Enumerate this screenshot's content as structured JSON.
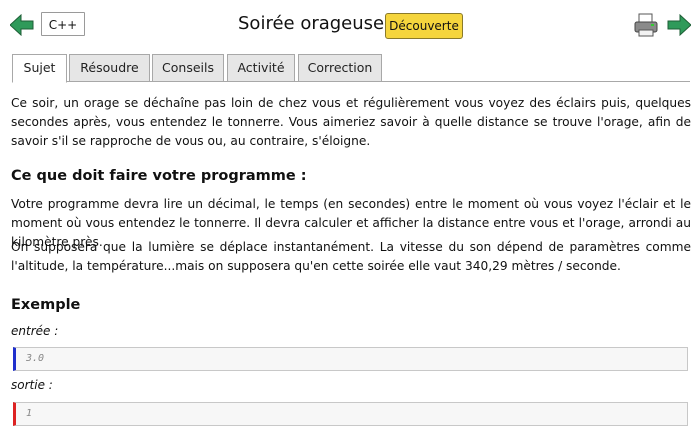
{
  "header": {
    "language_label": "C++",
    "title": "Soirée orageuse",
    "badge": "Découverte"
  },
  "tabs": [
    "Sujet",
    "Résoudre",
    "Conseils",
    "Activité",
    "Correction"
  ],
  "content": {
    "intro": "Ce soir, un orage se déchaîne pas loin de chez vous et régulièrement vous voyez des éclairs puis, quelques secondes après, vous entendez le tonnerre. Vous aimeriez savoir à quelle distance se trouve l'orage, afin de savoir s'il se rapproche de vous ou, au contraire, s'éloigne.",
    "program_heading": "Ce que doit faire votre programme :",
    "program_text": "Votre programme devra lire un décimal, le temps (en secondes) entre le moment où vous voyez l'éclair et le moment où vous entendez le tonnerre. Il devra calculer et afficher la distance entre vous et l'orage, arrondi au kilomètre près.",
    "assumption_text": "On supposera que la lumière se déplace instantanément. La vitesse du son dépend de paramètres comme l'altitude, la température...mais on supposera qu'en cette soirée elle vaut 340,29 mètres / seconde.",
    "example_heading": "Exemple",
    "input_label": "entrée :",
    "input_value": "3.0",
    "output_label": "sortie :",
    "output_value": "1"
  },
  "icons": {
    "back": "left-arrow-icon",
    "forward": "right-arrow-icon",
    "print": "printer-icon",
    "io_hook": "↳"
  },
  "colors": {
    "arrow": "#2e8b57",
    "badge": "#f5d53d",
    "input_bar": "#1f2fcc",
    "output_bar": "#dd2222"
  }
}
